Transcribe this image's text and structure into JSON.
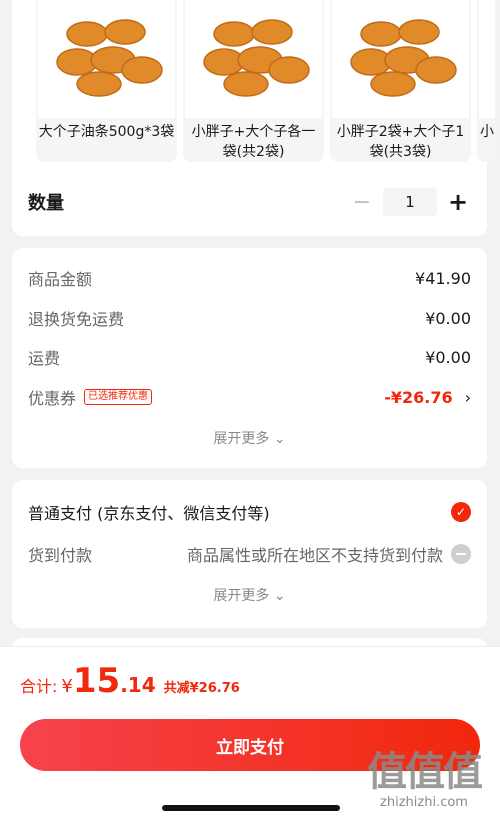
{
  "variants": [
    {
      "label": "大个子油条500g*3袋"
    },
    {
      "label": "小胖子+大个子各一袋(共2袋)"
    },
    {
      "label": "小胖子2袋+大个子1袋(共3袋)"
    },
    {
      "label": "小"
    }
  ],
  "quantity": {
    "title": "数量",
    "minus": "−",
    "value": "1",
    "plus": "+"
  },
  "summary": {
    "goods_amount": {
      "label": "商品金额",
      "value": "¥41.90"
    },
    "return_shipping": {
      "label": "退换货免运费",
      "value": "¥0.00"
    },
    "shipping": {
      "label": "运费",
      "value": "¥0.00"
    },
    "coupon": {
      "label": "优惠券",
      "badge": "已选推荐优惠",
      "value": "-¥26.76",
      "chevron": "›"
    },
    "more": "展开更多 ⌄"
  },
  "payment": {
    "normal": {
      "label": "普通支付 (京东支付、微信支付等)",
      "check": "✓"
    },
    "cod": {
      "label": "货到付款",
      "note": "商品属性或所在地区不支持货到付款"
    },
    "more": "展开更多 ⌄"
  },
  "footer": {
    "total_label": "合计:",
    "currency": "¥",
    "total_int": "15",
    "total_dec": ".14",
    "saved": "共减¥26.76",
    "pay_button": "立即支付"
  },
  "watermark": {
    "glyph": "值值值",
    "url": "zhizhizhi.com"
  },
  "colors": {
    "accent": "#f2270c",
    "background": "#f2f2f2"
  }
}
